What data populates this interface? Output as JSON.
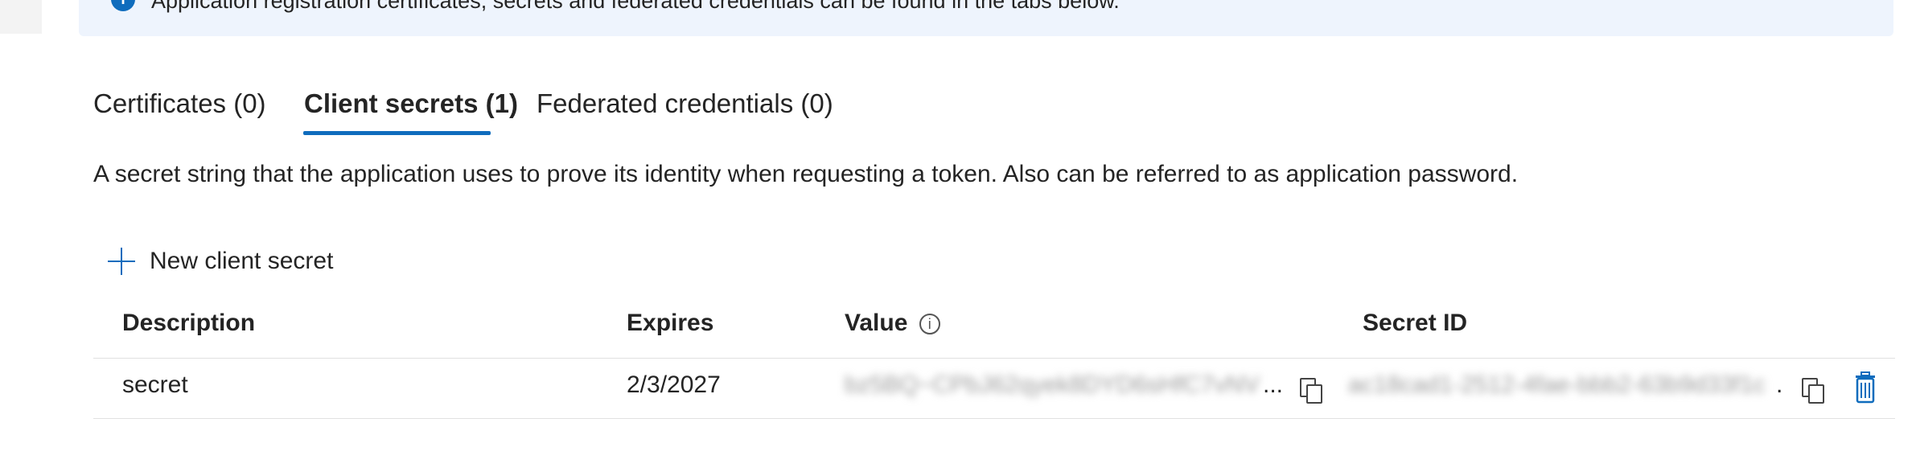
{
  "banner": {
    "text": "Application registration certificates, secrets and federated credentials can be found in the tabs below."
  },
  "tabs": [
    {
      "label": "Certificates (0)",
      "active": false
    },
    {
      "label": "Client secrets (1)",
      "active": true
    },
    {
      "label": "Federated credentials (0)",
      "active": false
    }
  ],
  "description": "A secret string that the application uses to prove its identity when requesting a token. Also can be referred to as application password.",
  "commands": {
    "new_secret_label": "New client secret"
  },
  "table": {
    "columns": [
      "Description",
      "Expires",
      "Value",
      "Secret ID"
    ],
    "rows": [
      {
        "description": "secret",
        "expires": "2/3/2027",
        "value_blurred": "bz5BQ~CPbJ62qyek8DYD6sHfC7vNVkB",
        "secret_id_blurred": "ac18cad1-2512-4fae-bbb2-63b9d33f1c",
        "ellipsis": "..."
      }
    ]
  },
  "colors": {
    "accent": "#0f6cbd",
    "banner_bg": "#eef4fd",
    "text": "#242424",
    "delete": "#0f6cbd"
  },
  "icons": [
    "info-icon",
    "plus-icon",
    "copy-icon",
    "delete-icon"
  ]
}
